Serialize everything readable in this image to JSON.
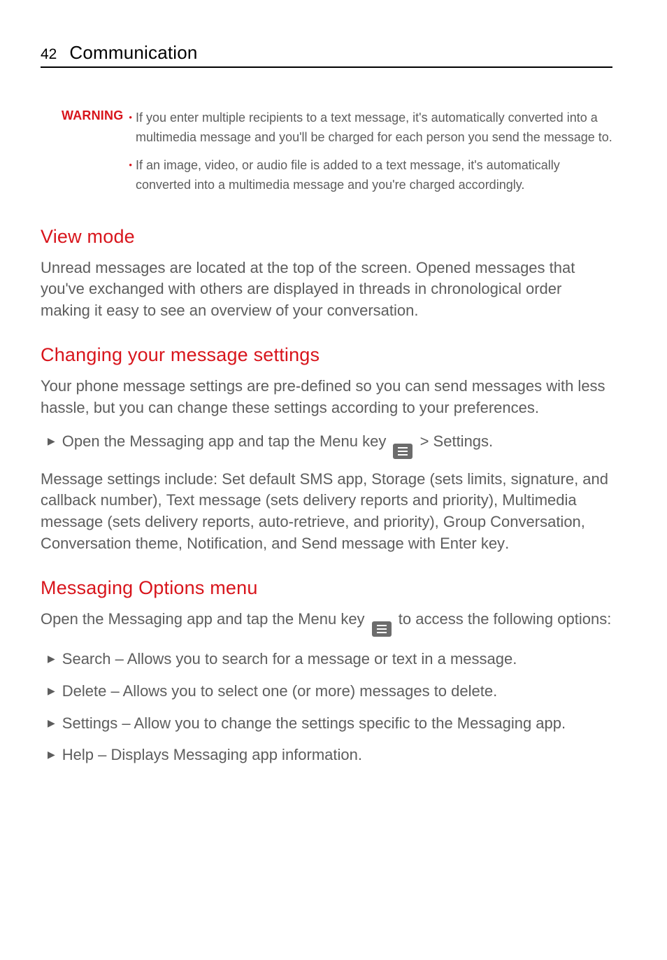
{
  "header": {
    "page_number": "42",
    "chapter_title": "Communication"
  },
  "warning": {
    "label": "WARNING",
    "items": [
      "If you enter multiple recipients to a text message, it's automatically converted into a multimedia message and you'll be charged for each person you send the message to.",
      "If an image, video, or audio file is added to a text message, it's automatically converted into a multimedia message and you're charged accordingly."
    ]
  },
  "sections": {
    "view_mode": {
      "title": "View mode",
      "body": "Unread messages are located at the top of the screen. Opened messages that you've exchanged with others are displayed in threads in chronological order making it easy to see an overview of your conversation."
    },
    "changing_settings": {
      "title": "Changing your message settings",
      "body": "Your phone message settings are pre-defined so you can send messages with less hassle, but you can change these settings according to your preferences.",
      "step_parts": {
        "t1": "Open the ",
        "b1": "Messaging",
        "t2": " app and tap the ",
        "b2": "Menu key",
        "t3": " > ",
        "b3": "Settings",
        "t4": "."
      },
      "settings_parts": {
        "p1": "Message settings include: ",
        "b1": "Set default SMS app",
        "c1": ", ",
        "b2": "Storage",
        "p2": " (sets limits, signature, and callback number), ",
        "b3": "Text message",
        "p3": " (sets delivery reports and priority), ",
        "b4": "Multimedia message",
        "p4": " (sets delivery reports, auto-retrieve, and priority), ",
        "b5": "Group Conversation",
        "c2": ", ",
        "b6": "Conversation theme",
        "c3": ", ",
        "b7": "Notification",
        "p5": ", and ",
        "b8": "Send message with Enter key",
        "p6": "."
      }
    },
    "options_menu": {
      "title": "Messaging Options menu",
      "intro_parts": {
        "t1": "Open the ",
        "b1": "Messaging",
        "t2": " app and tap the ",
        "b2": "Menu key",
        "t3": " to access the following options:"
      },
      "options": [
        {
          "name": "Search",
          "desc": " – Allows you to search for a message or text in a message."
        },
        {
          "name": "Delete",
          "desc": " – Allows you to select one (or more) messages to delete."
        },
        {
          "name": "Settings",
          "desc": " – Allow you to change the settings specific to the Messaging app."
        },
        {
          "name": "Help",
          "desc": " – Displays Messaging app information."
        }
      ]
    }
  }
}
